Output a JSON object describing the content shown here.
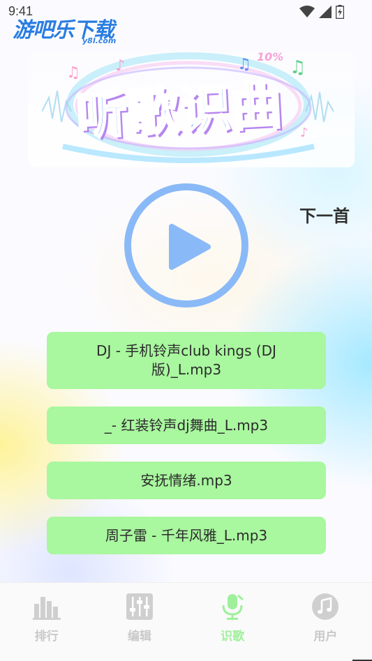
{
  "status_bar": {
    "time": "9:41"
  },
  "watermark": {
    "main": "游吧乐下载",
    "sub": "y8l.com"
  },
  "banner": {
    "title": "听歌识曲",
    "badge": "10%"
  },
  "player": {
    "next_label": "下一首"
  },
  "songs": [
    {
      "title": "DJ - 手机铃声club kings (DJ版)_L.mp3"
    },
    {
      "title": "_- 红装铃声dj舞曲_L.mp3"
    },
    {
      "title": "安抚情绪.mp3"
    },
    {
      "title": "周子雷 - 千年风雅_L.mp3"
    }
  ],
  "tabs": [
    {
      "label": "排行",
      "icon": "bar-chart-icon",
      "active": false
    },
    {
      "label": "编辑",
      "icon": "sliders-icon",
      "active": false
    },
    {
      "label": "识歌",
      "icon": "microphone-icon",
      "active": true
    },
    {
      "label": "用户",
      "icon": "music-note-icon",
      "active": false
    }
  ],
  "colors": {
    "accent_blue": "#8ab9f7",
    "song_item_bg": "#a9f79f",
    "tab_active": "#9ef09a",
    "tab_inactive": "#c9c9c9"
  }
}
